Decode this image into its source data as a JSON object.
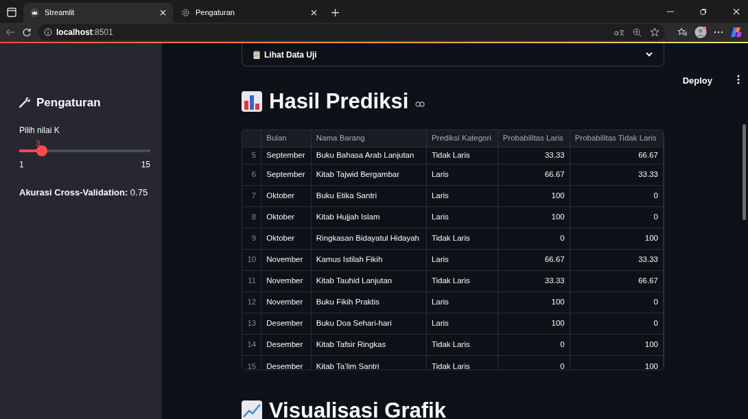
{
  "browser": {
    "tabs": [
      {
        "label": "Streamlit",
        "selected": true
      },
      {
        "label": "Pengaturan",
        "selected": false
      }
    ],
    "address": {
      "host": "localhost",
      "port": ":8501"
    }
  },
  "toolbar": {
    "deploy": "Deploy"
  },
  "sidebar": {
    "title": "Pengaturan",
    "slider": {
      "label": "Pilih nilai K",
      "value": "3",
      "min": "1",
      "max": "15",
      "level": 0.143
    },
    "accuracy": {
      "label": "Akurasi Cross-Validation:",
      "value": "0.75"
    }
  },
  "expander": {
    "label": "Lihat Data Uji",
    "expanded": false
  },
  "heading": "Hasil Prediksi",
  "table": {
    "columns": [
      "",
      "Bulan",
      "Nama Barang",
      "Prediksi Kategori",
      "Probabilitas Laris",
      "Probabilitas Tidak Laris"
    ],
    "rows": [
      [
        "5",
        "September",
        "Buku Bahasa Arab Lanjutan",
        "Tidak Laris",
        "33.33",
        "66.67"
      ],
      [
        "6",
        "September",
        "Kitab Tajwid Bergambar",
        "Laris",
        "66.67",
        "33.33"
      ],
      [
        "7",
        "Oktober",
        "Buku Etika Santri",
        "Laris",
        "100",
        "0"
      ],
      [
        "8",
        "Oktober",
        "Kitab Hujjah Islam",
        "Laris",
        "100",
        "0"
      ],
      [
        "9",
        "Oktober",
        "Ringkasan Bidayatul Hidayah",
        "Tidak Laris",
        "0",
        "100"
      ],
      [
        "10",
        "November",
        "Kamus Istilah Fikih",
        "Laris",
        "66.67",
        "33.33"
      ],
      [
        "11",
        "November",
        "Kitab Tauhid Lanjutan",
        "Tidak Laris",
        "33.33",
        "66.67"
      ],
      [
        "12",
        "November",
        "Buku Fikih Praktis",
        "Laris",
        "100",
        "0"
      ],
      [
        "13",
        "Desember",
        "Buku Doa Sehari-hari",
        "Laris",
        "100",
        "0"
      ],
      [
        "14",
        "Desember",
        "Kitab Tafsir Ringkas",
        "Tidak Laris",
        "0",
        "100"
      ],
      [
        "15",
        "Desember",
        "Kitab Ta’lim Santri",
        "Tidak Laris",
        "0",
        "100"
      ]
    ]
  },
  "heading2": "Visualisasi Grafik"
}
